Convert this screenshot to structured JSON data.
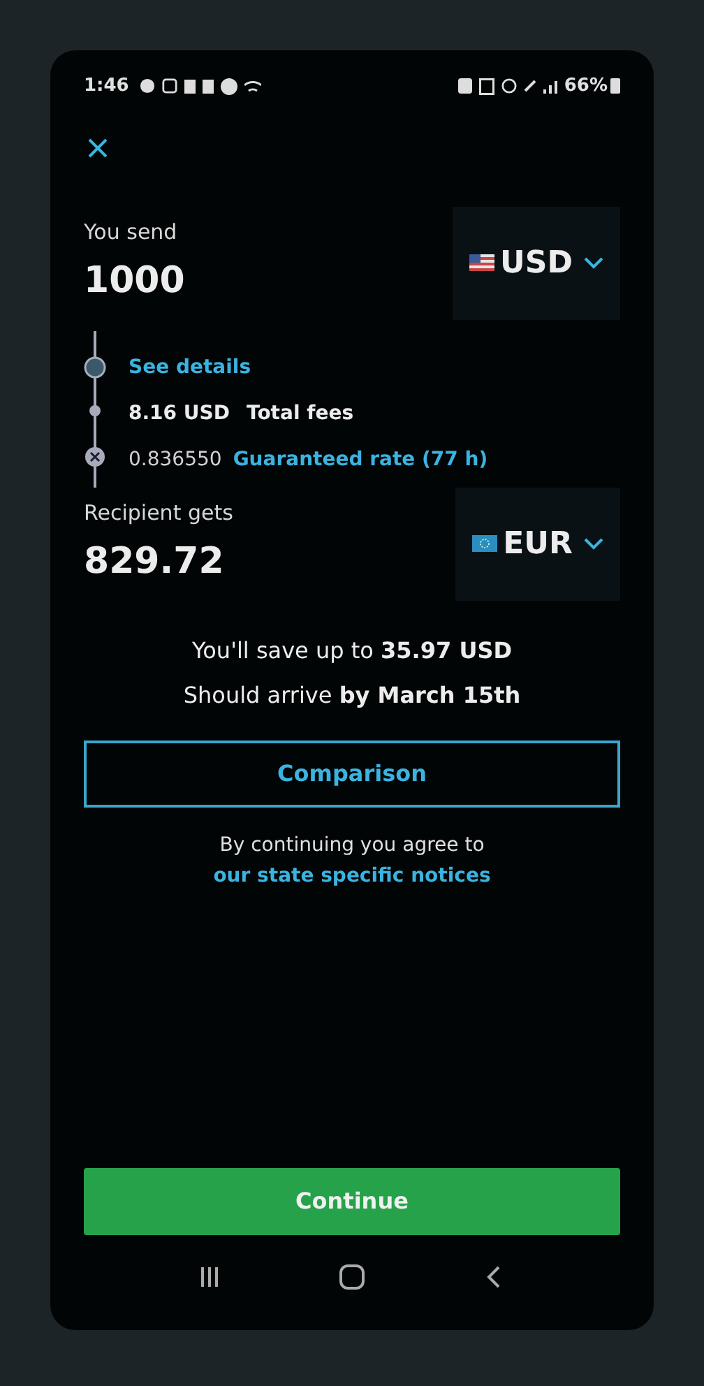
{
  "status_bar": {
    "time": "1:46",
    "battery": "66%"
  },
  "send": {
    "label": "You send",
    "amount": "1000",
    "currency": "USD"
  },
  "breakdown": {
    "details_link": "See details",
    "fee_amount": "8.16 USD",
    "fee_label": "Total fees",
    "rate": "0.836550",
    "rate_label": "Guaranteed rate (77 h)"
  },
  "recipient": {
    "label": "Recipient gets",
    "amount": "829.72",
    "currency": "EUR"
  },
  "summary": [
    "You'll save up to **35.97 USD**",
    "Should arrive **by March 15th**"
  ],
  "comparison_button": "Comparison",
  "notice": {
    "text": "By continuing you agree to",
    "link": "our state specific notices"
  },
  "continue_button": "Continue"
}
